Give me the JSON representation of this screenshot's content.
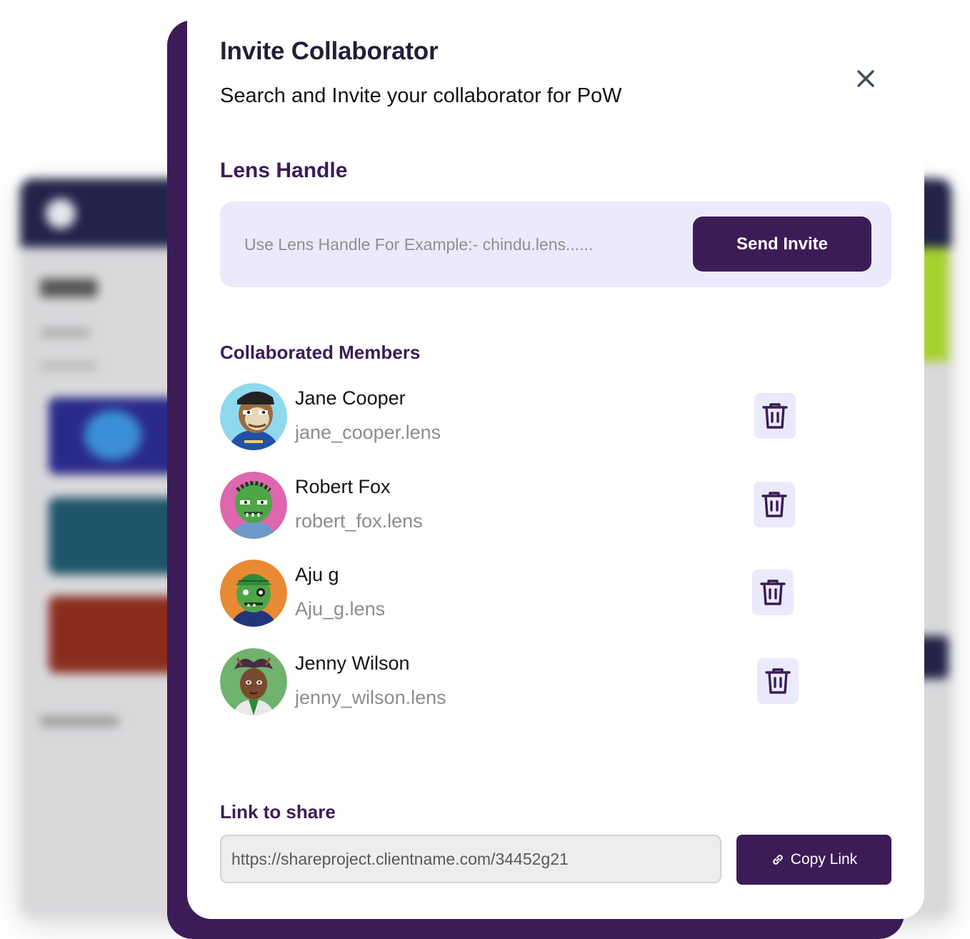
{
  "modal": {
    "title": "Invite Collaborator",
    "subtitle": "Search and Invite your collaborator for PoW"
  },
  "lens": {
    "section_title": "Lens Handle",
    "input_placeholder": "Use Lens Handle For Example:- chindu.lens......",
    "input_value": "",
    "send_label": "Send Invite"
  },
  "members": {
    "section_title": "Collaborated Members",
    "items": [
      {
        "name": "Jane Cooper",
        "handle": "jane_cooper.lens",
        "avatar_color": "#8fd9ee"
      },
      {
        "name": "Robert Fox",
        "handle": "robert_fox.lens",
        "avatar_color": "#de67b0"
      },
      {
        "name": "Aju g",
        "handle": "Aju_g.lens",
        "avatar_color": "#e88a33"
      },
      {
        "name": "Jenny Wilson",
        "handle": "jenny_wilson.lens",
        "avatar_color": "#6fb36e"
      }
    ]
  },
  "share": {
    "section_title": "Link to share",
    "link_value": "https://shareproject.clientname.com/34452g21",
    "copy_label": "Copy Link"
  },
  "icons": {
    "close": "close-icon",
    "delete": "trash-icon",
    "copy": "link-icon"
  },
  "colors": {
    "accent": "#3c1c57",
    "soft_bg": "#ebeafc",
    "title": "#1f1f3a"
  }
}
